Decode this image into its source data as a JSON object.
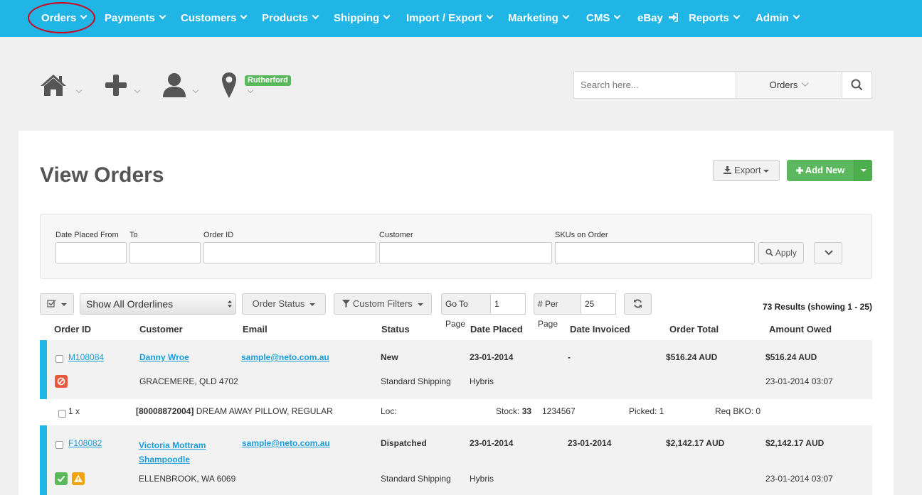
{
  "nav": {
    "items": [
      {
        "label": "Orders"
      },
      {
        "label": "Payments"
      },
      {
        "label": "Customers"
      },
      {
        "label": "Products"
      },
      {
        "label": "Shipping"
      },
      {
        "label": "Import / Export"
      },
      {
        "label": "Marketing"
      },
      {
        "label": "CMS"
      },
      {
        "label": "eBay"
      },
      {
        "label": "Reports"
      },
      {
        "label": "Admin"
      }
    ]
  },
  "quick": {
    "location_badge": "Rutherford"
  },
  "search": {
    "placeholder": "Search here...",
    "scope": "Orders"
  },
  "page": {
    "title": "View Orders",
    "export_label": "Export",
    "add_new_label": "Add New"
  },
  "filters": {
    "date_from_label": "Date Placed From",
    "to_label": "To",
    "order_id_label": "Order ID",
    "customer_label": "Customer",
    "skus_label": "SKUs on Order",
    "apply_label": "Apply"
  },
  "toolbar": {
    "orderlines_select": "Show All Orderlines",
    "order_status_label": "Order Status",
    "custom_filters_label": "Custom Filters",
    "goto_label": "Go To Page",
    "goto_value": "1",
    "perpage_label": "# Per Page",
    "perpage_value": "25",
    "results": "73 Results (showing 1 - 25)"
  },
  "table": {
    "headers": [
      "Order ID",
      "Customer",
      "Email",
      "Status",
      "Date Placed",
      "Date Invoiced",
      "Order Total",
      "Amount Owed"
    ],
    "orders": [
      {
        "id": "M108084",
        "customer": "Danny Wroe",
        "email": "sample@neto.com.au",
        "status": "New",
        "date_placed": "23-01-2014",
        "date_invoiced": "-",
        "total": "$516.24 AUD",
        "owed": "$516.24 AUD",
        "address": "GRACEMERE, QLD 4702",
        "shipping": "Standard Shipping",
        "source": "Hybris",
        "timestamp": "23-01-2014 03:07"
      },
      {
        "id": "F108082",
        "customer_line1": "Victoria Mottram",
        "customer_line2": "Shampoodle",
        "email": "sample@neto.com.au",
        "status": "Dispatched",
        "date_placed": "23-01-2014",
        "date_invoiced": "23-01-2014",
        "total": "$2,142.17 AUD",
        "owed": "$2,142.17 AUD",
        "address": "ELLENBROOK, WA 6069",
        "shipping": "Standard Shipping",
        "source": "Hybris",
        "timestamp": "23-01-2014 03:07"
      }
    ],
    "orderline": {
      "qty": "1 x",
      "sku": "[80008872004]",
      "name": " DREAM AWAY PILLOW, REGULAR",
      "loc_label": "Loc:",
      "stock_label": "Stock: ",
      "stock_value": "33",
      "barcode": "1234567",
      "picked": "Picked: 1",
      "req_bko": "Req BKO: 0"
    }
  },
  "colors": {
    "nav_bg": "#21b5e6",
    "accent_bar": "#1fb5e6",
    "success": "#5cb85c",
    "danger": "#e8573f",
    "warning": "#f0a30a",
    "link": "#1a9dd9",
    "annotation": "#d0021b"
  }
}
